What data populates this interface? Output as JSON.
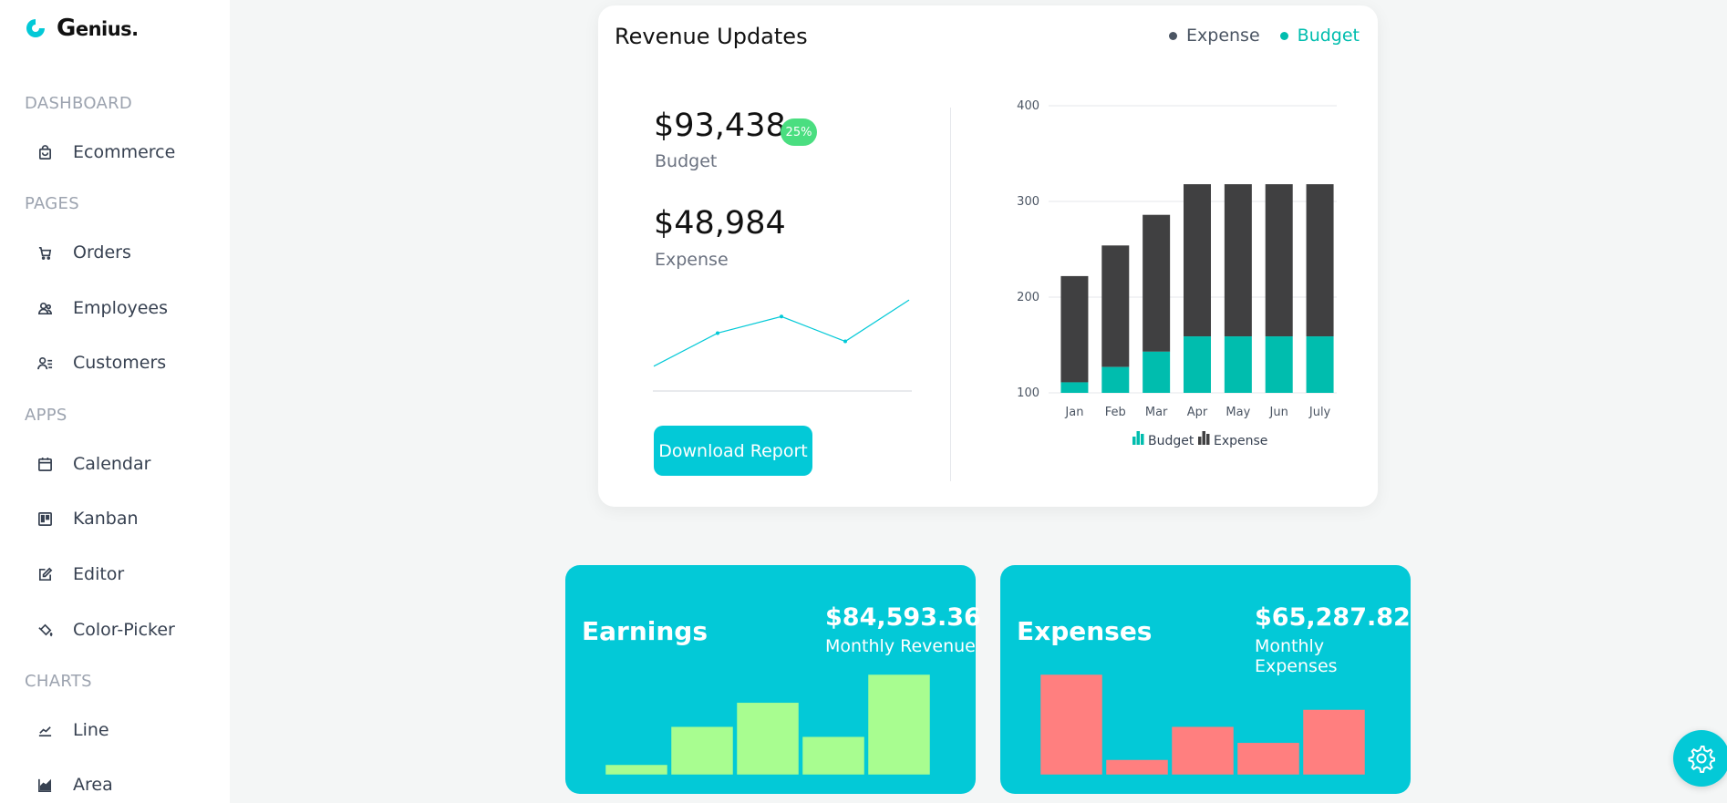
{
  "brand": {
    "name_big": "G",
    "name_rest": "enius."
  },
  "sidebar": {
    "sections": [
      {
        "title": "DASHBOARD",
        "items": [
          {
            "label": "Ecommerce",
            "icon": "shopping-bag-icon"
          }
        ]
      },
      {
        "title": "PAGES",
        "items": [
          {
            "label": "Orders",
            "icon": "cart-icon"
          },
          {
            "label": "Employees",
            "icon": "users-icon"
          },
          {
            "label": "Customers",
            "icon": "customer-icon"
          }
        ]
      },
      {
        "title": "APPS",
        "items": [
          {
            "label": "Calendar",
            "icon": "calendar-icon"
          },
          {
            "label": "Kanban",
            "icon": "kanban-icon"
          },
          {
            "label": "Editor",
            "icon": "edit-icon"
          },
          {
            "label": "Color-Picker",
            "icon": "paint-bucket-icon"
          }
        ]
      },
      {
        "title": "CHARTS",
        "items": [
          {
            "label": "Line",
            "icon": "line-chart-icon"
          },
          {
            "label": "Area",
            "icon": "area-chart-icon"
          }
        ]
      }
    ]
  },
  "revenue": {
    "title": "Revenue Updates",
    "legend": {
      "expense": "Expense",
      "budget": "Budget"
    },
    "budget_value": "$93,438",
    "budget_label": "Budget",
    "badge": "25%",
    "expense_value": "$48,984",
    "expense_label": "Expense",
    "download_label": "Download Report"
  },
  "colors": {
    "accent": "#03c9d7",
    "dark": "#404041",
    "budget": "#00bdae",
    "green": "#a8fd90",
    "red": "#ff7f7f"
  },
  "chart_data": [
    {
      "type": "line",
      "title": "",
      "x": [
        1,
        2,
        3,
        4,
        5
      ],
      "series": [
        {
          "values": [
            2,
            6,
            8,
            5,
            10
          ]
        }
      ]
    },
    {
      "type": "bar",
      "stacked": true,
      "categories": [
        "Jan",
        "Feb",
        "Mar",
        "Apr",
        "May",
        "Jun",
        "July"
      ],
      "series": [
        {
          "name": "Budget",
          "values": [
            111,
            127,
            143,
            159,
            159,
            159,
            159
          ]
        },
        {
          "name": "Expense",
          "values": [
            111,
            127,
            143,
            159,
            159,
            159,
            159
          ]
        }
      ],
      "ylim": [
        100,
        400
      ],
      "yticks": [
        100,
        200,
        300,
        400
      ],
      "legend": "bottom"
    },
    {
      "type": "bar",
      "title": "Earnings",
      "values": [
        10,
        48,
        72,
        38,
        100
      ]
    },
    {
      "type": "bar",
      "title": "Expenses",
      "values": [
        100,
        15,
        48,
        32,
        65
      ]
    }
  ],
  "earnings": {
    "title": "Earnings",
    "amount": "$84,593.36",
    "sub": "Monthly Revenue"
  },
  "expenses": {
    "title": "Expenses",
    "amount": "$65,287.82",
    "sub": "Monthly Expenses"
  }
}
